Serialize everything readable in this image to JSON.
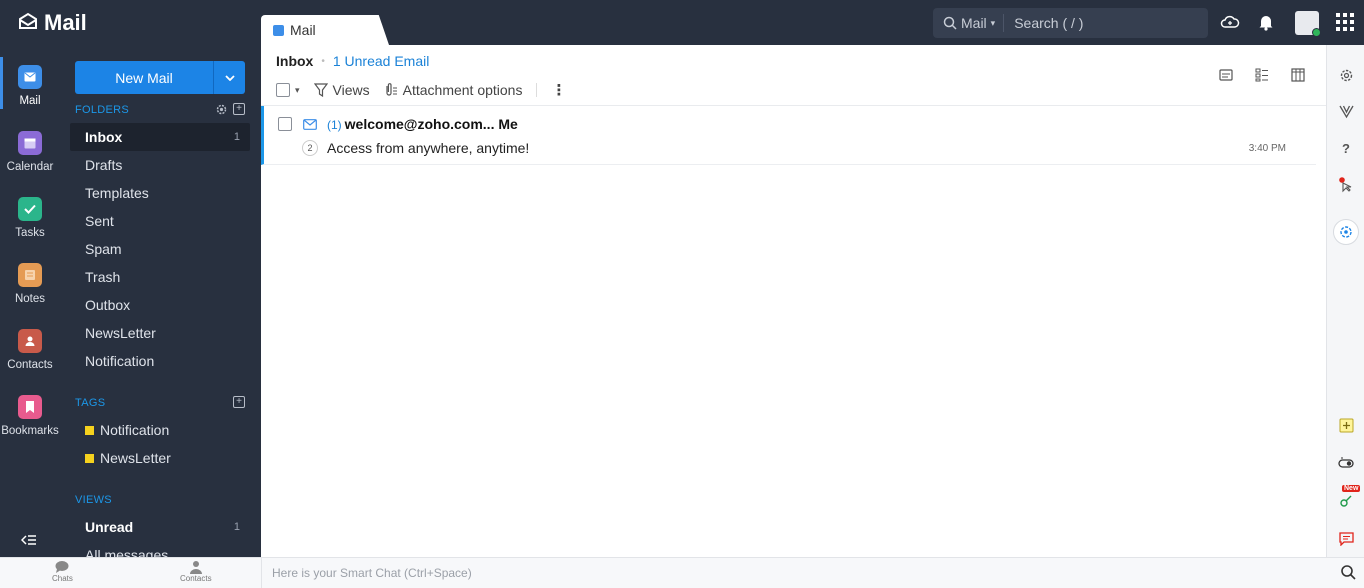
{
  "app": {
    "title": "Mail"
  },
  "tab": {
    "label": "Mail"
  },
  "search": {
    "scope": "Mail",
    "placeholder": "Search ( / )"
  },
  "rail": {
    "items": [
      {
        "label": "Mail",
        "color": "#3d8ee8"
      },
      {
        "label": "Calendar",
        "color": "#8b6bd6"
      },
      {
        "label": "Tasks",
        "color": "#2bb58b"
      },
      {
        "label": "Notes",
        "color": "#e59b54"
      },
      {
        "label": "Contacts",
        "color": "#c85a4a"
      },
      {
        "label": "Bookmarks",
        "color": "#e85b8e"
      }
    ]
  },
  "panel": {
    "new_mail": "New Mail",
    "folders_header": "FOLDERS",
    "folders": [
      {
        "label": "Inbox",
        "count": "1"
      },
      {
        "label": "Drafts"
      },
      {
        "label": "Templates"
      },
      {
        "label": "Sent"
      },
      {
        "label": "Spam"
      },
      {
        "label": "Trash"
      },
      {
        "label": "Outbox"
      },
      {
        "label": "NewsLetter"
      },
      {
        "label": "Notification"
      }
    ],
    "tags_header": "TAGS",
    "tags": [
      {
        "label": "Notification",
        "color": "#f6d21e"
      },
      {
        "label": "NewsLetter",
        "color": "#f6d21e"
      }
    ],
    "views_header": "VIEWS",
    "views": [
      {
        "label": "Unread",
        "count": "1"
      },
      {
        "label": "All messages"
      }
    ]
  },
  "main": {
    "title": "Inbox",
    "unread_link": "1 Unread Email",
    "toolbar": {
      "views": "Views",
      "attachment": "Attachment options"
    },
    "messages": [
      {
        "count": "(1)",
        "from": "welcome@zoho.com... Me",
        "thread": "2",
        "subject": "Access from anywhere, anytime!",
        "time": "3:40 PM"
      }
    ]
  },
  "bottom": {
    "chats": "Chats",
    "contacts": "Contacts",
    "smart_chat": "Here is your Smart Chat (Ctrl+Space)"
  },
  "right_rail": {
    "new_badge": "New"
  }
}
